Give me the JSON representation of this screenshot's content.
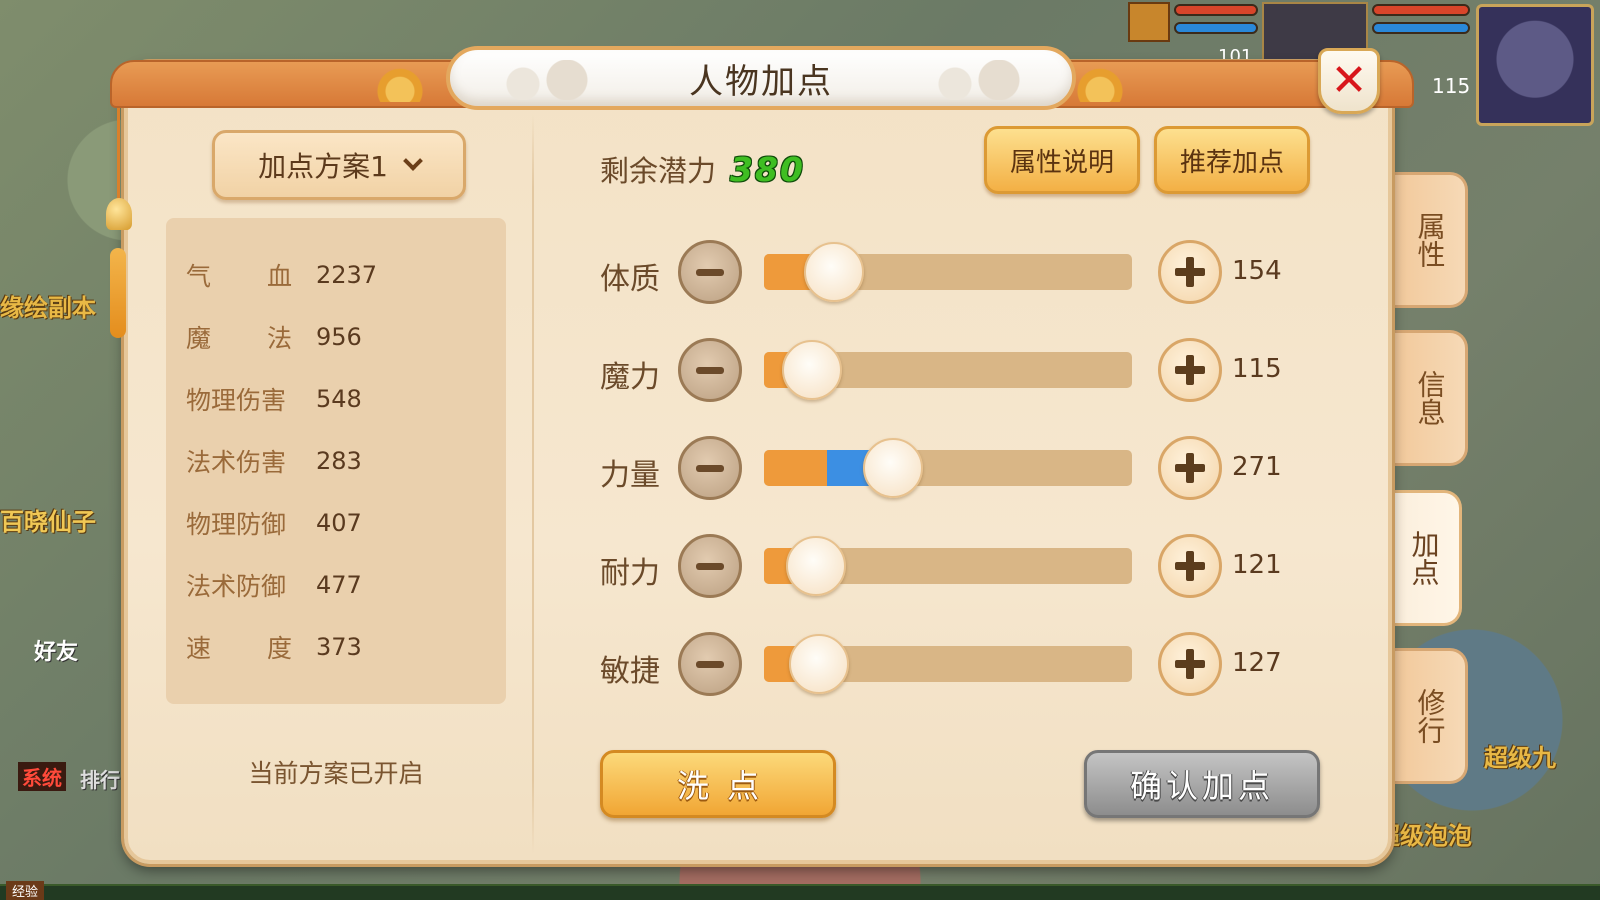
{
  "dialog": {
    "title": "人物加点",
    "close_icon": "close-icon"
  },
  "plan": {
    "dropdown_label": "加点方案1",
    "status": "当前方案已开启"
  },
  "stats": [
    {
      "label": "气血",
      "value": "2237"
    },
    {
      "label": "魔法",
      "value": "956"
    },
    {
      "label": "物理伤害",
      "value": "548"
    },
    {
      "label": "法术伤害",
      "value": "283"
    },
    {
      "label": "物理防御",
      "value": "407"
    },
    {
      "label": "法术防御",
      "value": "477"
    },
    {
      "label": "速度",
      "value": "373"
    }
  ],
  "potential": {
    "label": "剩余潜力",
    "value": "380"
  },
  "buttons": {
    "attribute_info": "属性说明",
    "recommend": "推荐加点",
    "wash": "洗点",
    "confirm": "确认加点"
  },
  "attributes": [
    {
      "name": "体质",
      "value": "154",
      "base_fraction": 0.19,
      "added_fraction": 0.0
    },
    {
      "name": "魔力",
      "value": "115",
      "base_fraction": 0.13,
      "added_fraction": 0.0
    },
    {
      "name": "力量",
      "value": "271",
      "base_fraction": 0.17,
      "added_fraction": 0.18
    },
    {
      "name": "耐力",
      "value": "121",
      "base_fraction": 0.14,
      "added_fraction": 0.0
    },
    {
      "name": "敏捷",
      "value": "127",
      "base_fraction": 0.15,
      "added_fraction": 0.0
    }
  ],
  "side_tabs": [
    {
      "label": "属性",
      "active": false
    },
    {
      "label": "信息",
      "active": false
    },
    {
      "label": "加点",
      "active": true
    },
    {
      "label": "修行",
      "active": false
    }
  ],
  "background": {
    "labels": [
      "缘绘副本",
      "百晓仙子",
      "好友",
      "系统",
      "排行",
      "超级九",
      "超级泡泡",
      "经验"
    ],
    "hud_level_1": "101",
    "hud_level_2": "115"
  },
  "colors": {
    "fill_base": "#ee9a3b",
    "fill_added": "#3c8fe3",
    "potential_green": "#3fbe22",
    "accent_orange": "#f3b045"
  }
}
